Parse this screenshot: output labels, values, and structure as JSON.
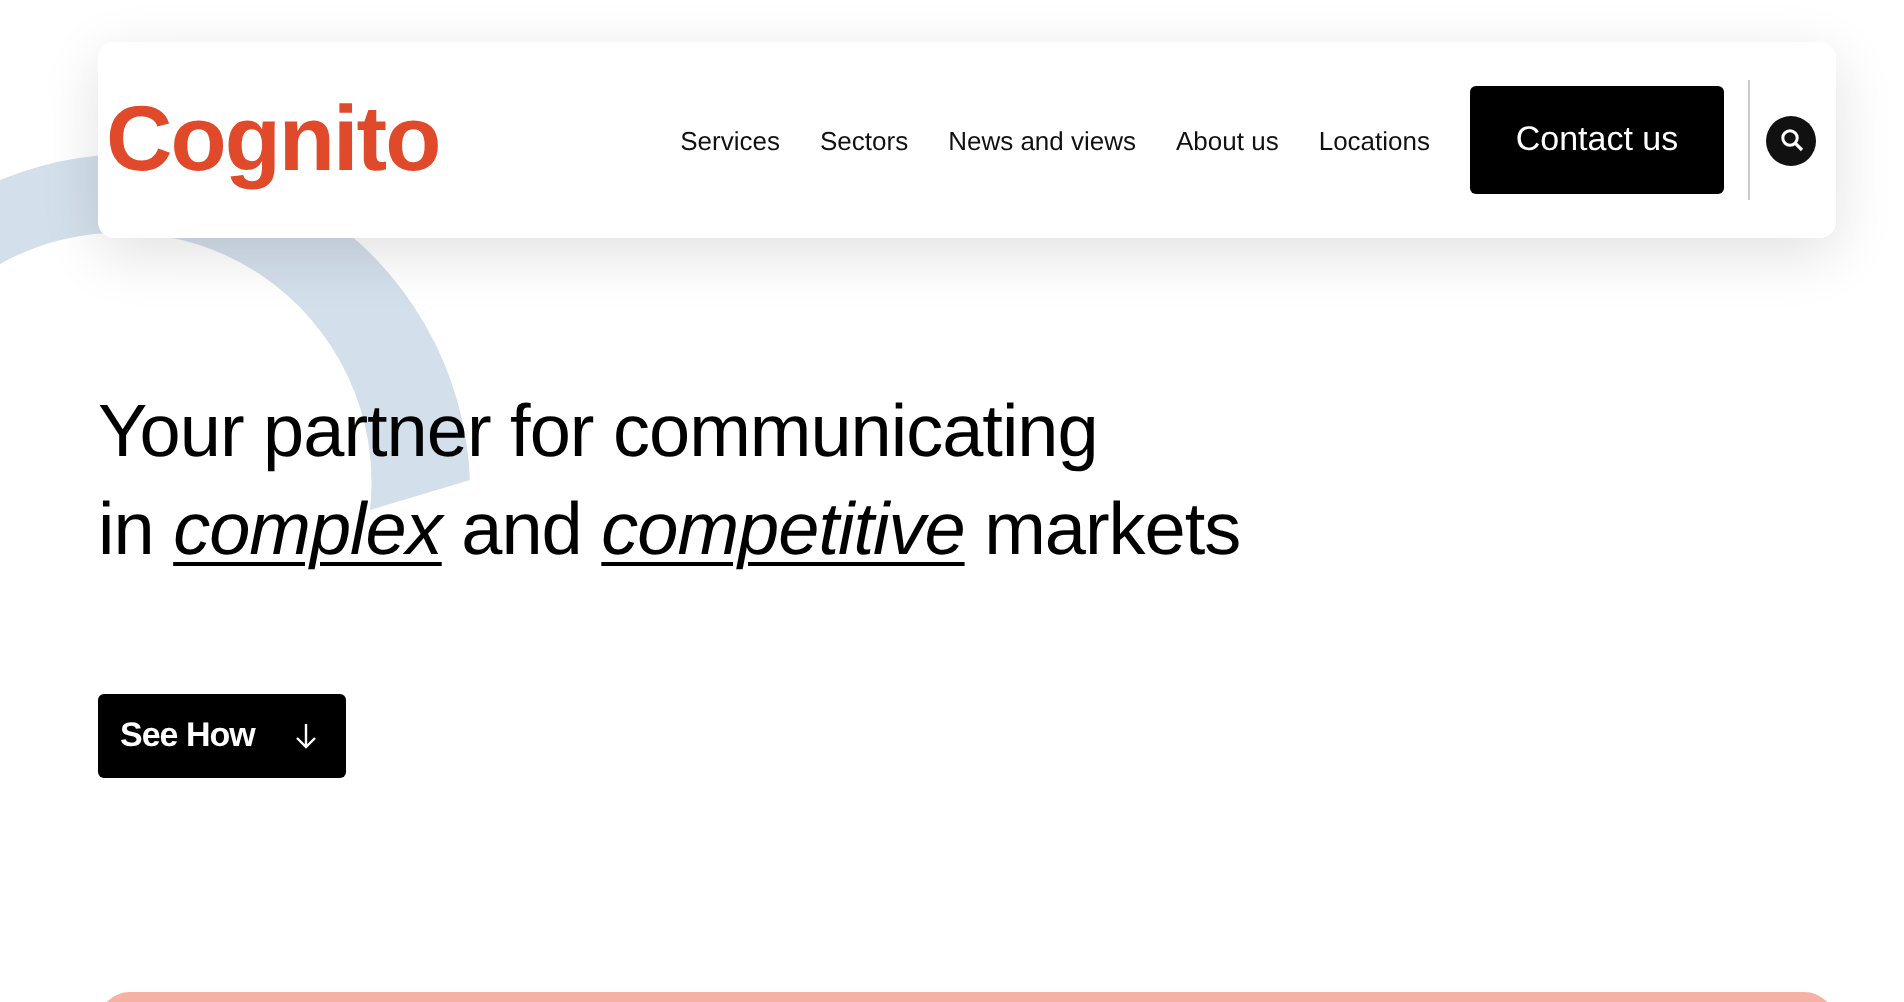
{
  "header": {
    "logo": "Cognito",
    "nav": [
      {
        "label": "Services"
      },
      {
        "label": "Sectors"
      },
      {
        "label": "News and views"
      },
      {
        "label": "About us"
      },
      {
        "label": "Locations"
      }
    ],
    "contact_button": "Contact us"
  },
  "hero": {
    "headline_lines": [
      "Your partner for communicating",
      "in *complex* and *competitive* markets"
    ],
    "button": "See How"
  }
}
